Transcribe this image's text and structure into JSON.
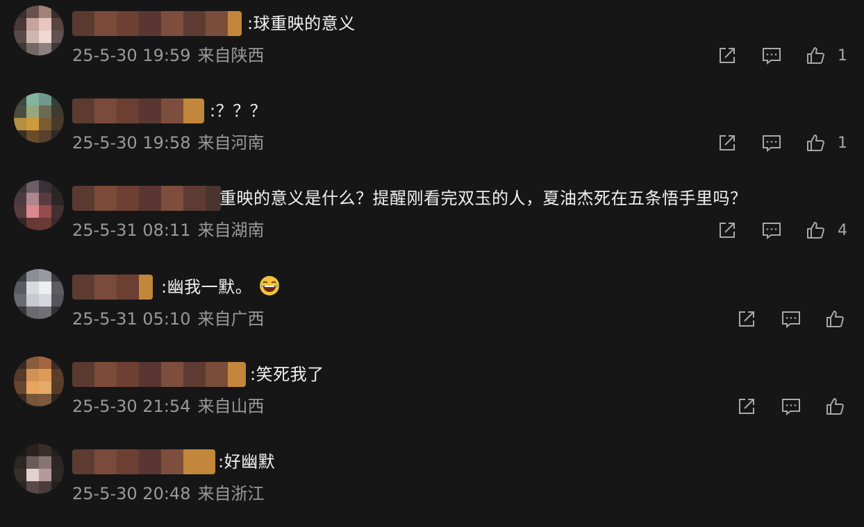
{
  "comments": [
    {
      "text": ":球重映的意义",
      "time": "25-5-30 19:59",
      "location": "来自陕西",
      "likes": "1"
    },
    {
      "text": ":？？？",
      "time": "25-5-30 19:58",
      "location": "来自河南",
      "likes": "1"
    },
    {
      "text": "重映的意义是什么？提醒刚看完双玉的人，夏油杰死在五条悟手里吗？",
      "time": "25-5-31 08:11",
      "location": "来自湖南",
      "likes": "4"
    },
    {
      "text": ":幽我一默。",
      "time": "25-5-31 05:10",
      "location": "来自广西",
      "likes": ""
    },
    {
      "text": ":笑死我了",
      "time": "25-5-30 21:54",
      "location": "来自山西",
      "likes": ""
    },
    {
      "text": ":好幽默",
      "time": "25-5-30 20:48",
      "location": "来自浙江",
      "likes": ""
    }
  ],
  "icons": {
    "share": "share-icon",
    "reply": "comment-icon",
    "like": "thumbs-up-icon",
    "emoji": "laughing-face-icon"
  },
  "colors": {
    "background": "#161616",
    "text": "#f2f2f2",
    "meta": "#9a9a9a",
    "icon": "#a9a9a9"
  }
}
